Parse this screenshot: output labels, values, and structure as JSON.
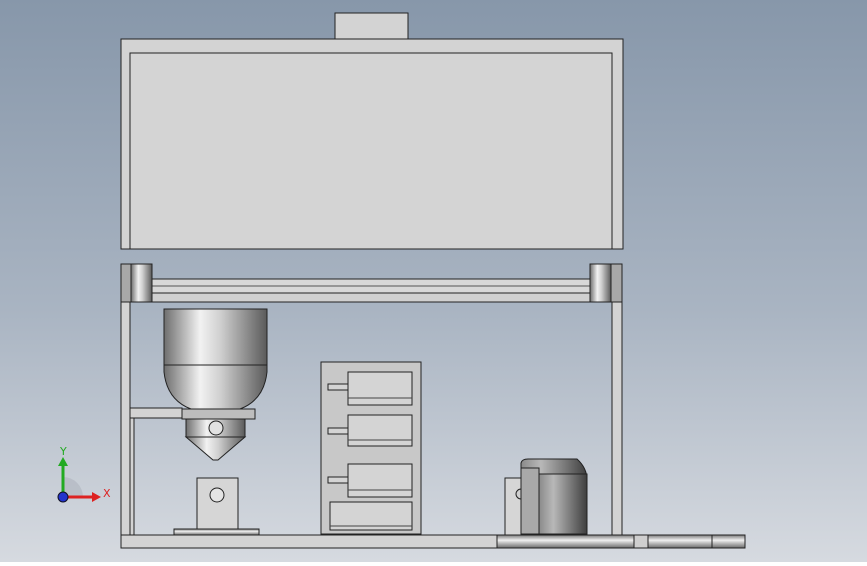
{
  "scene": {
    "background_top": "#8a99ab",
    "background_bottom": "#d5d9df",
    "part_fill": "#d3d3d3",
    "part_stroke": "#2a2a2a"
  },
  "triad": {
    "y_label": "Y",
    "x_label": "X",
    "y_color": "#22aa22",
    "x_color": "#dd2222",
    "z_color": "#2233cc"
  }
}
